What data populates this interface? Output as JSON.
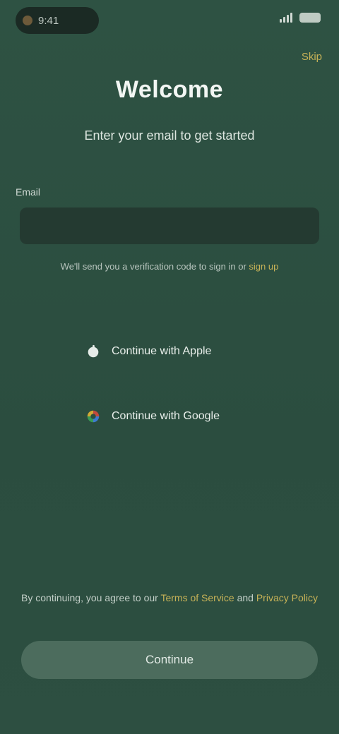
{
  "status_bar": {
    "time": "9:41"
  },
  "header": {
    "skip_label": "Skip",
    "title": "Welcome",
    "subtitle": "Enter your email to get started"
  },
  "form": {
    "email_label": "Email",
    "email_placeholder": "",
    "email_value": "",
    "helper_prefix": "We'll send you a verification code to sign in or",
    "helper_link": "sign up"
  },
  "social": {
    "apple_label": "Continue with Apple",
    "google_label": "Continue with Google"
  },
  "legal": {
    "prefix": "By continuing, you agree to our",
    "terms_link": "Terms of Service",
    "middle": "and",
    "privacy_link": "Privacy Policy"
  },
  "footer": {
    "continue_label": "Continue"
  },
  "colors": {
    "background": "#2c4f40",
    "accent": "#c7b257",
    "button": "#4c6c5d",
    "input": "#243a31"
  },
  "icons": {
    "apple": "apple-icon",
    "google": "google-icon",
    "signal": "signal-icon",
    "battery": "battery-icon"
  }
}
